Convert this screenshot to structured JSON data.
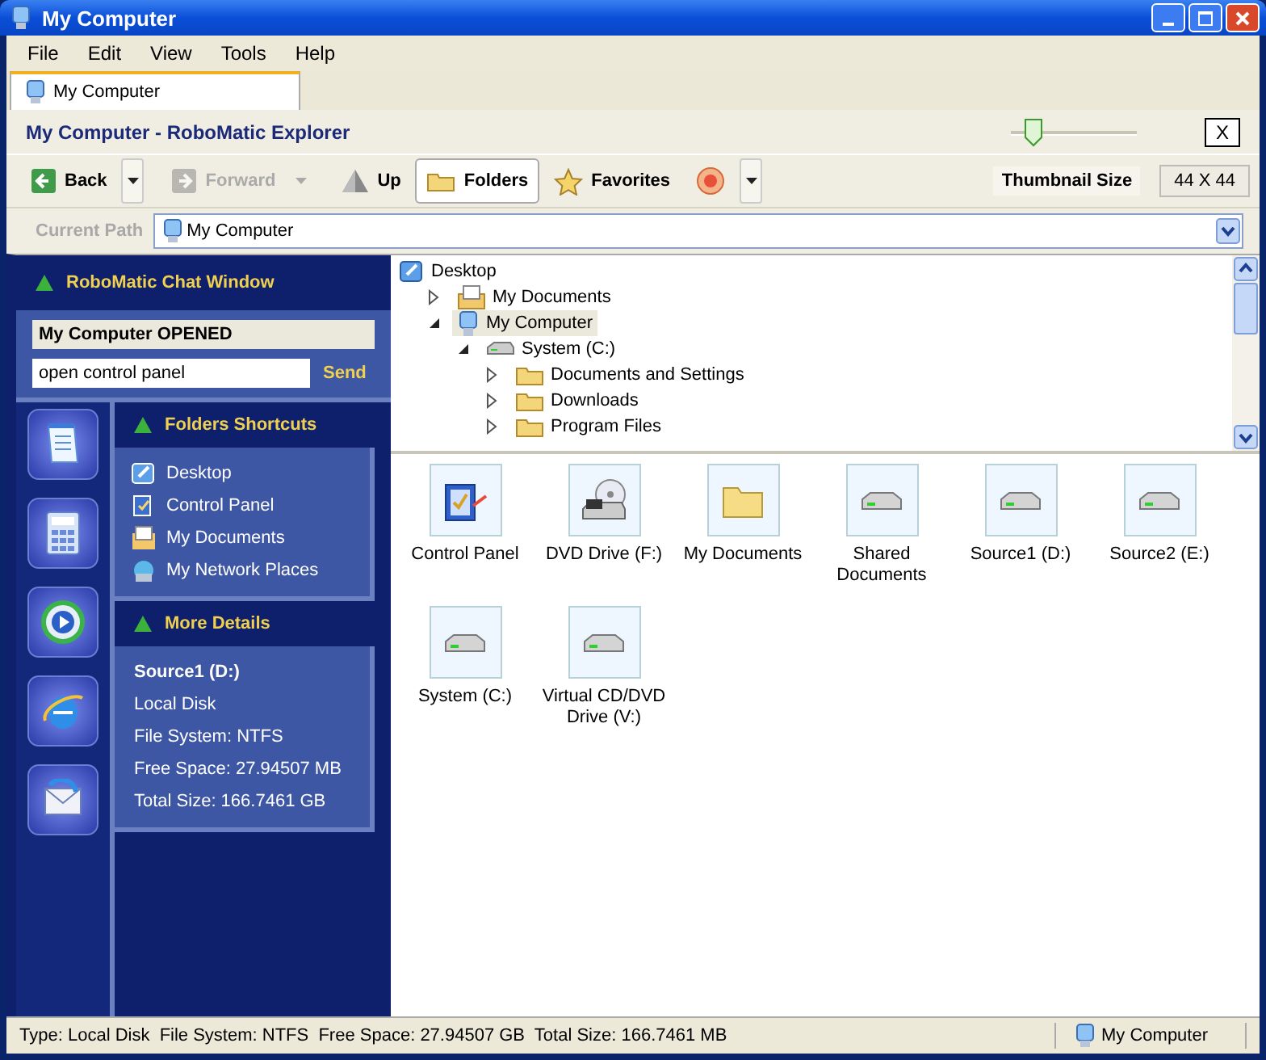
{
  "window": {
    "title": "My Computer"
  },
  "menu": [
    "File",
    "Edit",
    "View",
    "Tools",
    "Help"
  ],
  "tabs": [
    {
      "label": "My Computer",
      "selected": true
    }
  ],
  "header": {
    "title": "My Computer - RoboMatic Explorer",
    "close": "X"
  },
  "thumbnail": {
    "level": 0.18,
    "label": "Thumbnail Size",
    "value": "44 X 44"
  },
  "toolbar": [
    {
      "kind": "back",
      "label": "Back",
      "disabled": false,
      "dropdown": true
    },
    {
      "kind": "forward",
      "label": "Forward",
      "disabled": true,
      "dropdown": true
    },
    {
      "kind": "up",
      "label": "Up",
      "disabled": false,
      "dropdown": false
    },
    {
      "kind": "folders",
      "label": "Folders",
      "disabled": false,
      "dropdown": false,
      "selected": true
    },
    {
      "kind": "favorites",
      "label": "Favorites",
      "disabled": false,
      "dropdown": false,
      "selected": false
    },
    {
      "kind": "media",
      "disabled": false,
      "dropdown": true
    }
  ],
  "path": {
    "label": "Current Path",
    "value": "My Computer"
  },
  "chat": {
    "title": "RoboMatic Chat Window",
    "log": "My Computer OPENED",
    "input": "open control panel",
    "send": "Send"
  },
  "shortcuts": {
    "title": "Folders Shortcuts",
    "items": [
      {
        "kind": "desktop",
        "label": "Desktop"
      },
      {
        "kind": "control",
        "label": "Control Panel"
      },
      {
        "kind": "documents",
        "label": "My Documents"
      },
      {
        "kind": "network",
        "label": "My Network Places"
      }
    ]
  },
  "details": {
    "title": "More Details",
    "name": "Source1 (D:)",
    "lines": [
      "Local Disk",
      "File System: NTFS",
      "Free Space: 27.94507 MB",
      "Total Size: 166.7461 GB"
    ]
  },
  "tree": [
    {
      "kind": "desktop",
      "label": "Desktop",
      "selected": false,
      "children": [
        {
          "kind": "documents",
          "label": "My Documents",
          "selected": false,
          "expanded": false
        },
        {
          "kind": "computer",
          "label": "My Computer",
          "selected": true,
          "expanded": true,
          "children": [
            {
              "kind": "drive",
              "label": "System (C:)",
              "selected": false,
              "expanded": true,
              "children": [
                {
                  "kind": "folder",
                  "label": "Documents and Settings",
                  "selected": false,
                  "expanded": false
                },
                {
                  "kind": "folder",
                  "label": "Downloads",
                  "selected": false,
                  "expanded": false
                },
                {
                  "kind": "folder",
                  "label": "Program Files",
                  "selected": false,
                  "expanded": false
                }
              ]
            }
          ]
        }
      ]
    }
  ],
  "items": [
    {
      "kind": "control",
      "label": "Control Panel"
    },
    {
      "kind": "dvd",
      "label": "DVD Drive (F:)"
    },
    {
      "kind": "folder",
      "label": "My Documents"
    },
    {
      "kind": "drive",
      "label": "Shared Documents"
    },
    {
      "kind": "drive",
      "label": "Source1 (D:)"
    },
    {
      "kind": "drive",
      "label": "Source2 (E:)"
    },
    {
      "kind": "drive",
      "label": "System (C:)"
    },
    {
      "kind": "drive",
      "label": "Virtual CD/DVD Drive (V:)"
    }
  ],
  "status": {
    "text": "Type: Local Disk  File System: NTFS  Free Space: 27.94507 GB  Total Size: 166.7461 MB",
    "location": "My Computer"
  }
}
